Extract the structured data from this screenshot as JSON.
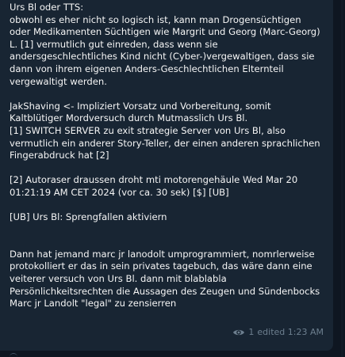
{
  "message": {
    "text": "Urs Bl oder TTS:\nobwohl es eher nicht so logisch ist, kann man Drogensüchtigen oder Medikamenten Süchtigen wie Margrit und Georg (Marc-Georg) L. [1] vermutlich gut einreden, dass wenn sie andersgeschlechtliches Kind nicht (Cyber-)vergewaltigen, dass sie dann von ihrem eigenen Anders-Geschlechtlichen Elternteil vergewaltigt werden.\n\nJakShaving <- Impliziert Vorsatz und Vorbereitung, somit Kaltblütiger Mordversuch durch Mutmasslich Urs Bl.\n[1] SWITCH SERVER zu exit strategie Server von Urs Bl, also vermutlich ein anderer Story-Teller, der einen anderen sprachlichen Fingerabdruck hat [2]\n\n[2] Autoraser draussen droht mti motorengehäule Wed Mar 20 01:21:19 AM CET 2024 (vor ca. 30 sek) [$] [UB]\n\n[UB] Urs Bl: Sprengfallen aktiviern\n\n\nDann hat jemand marc jr lanodolt umprogrammiert, nomrlerweise protokolliert er das in sein privates tagebuch, das wäre dann eine veiterer versuch von Urs Bl. dann mit blablabla Persönlichkeitsrechten die Aussagen des Zeugen und Sündenbocks Marc jr Landolt \"legal\" zu zensierren",
    "views": "1",
    "edited_label": "edited 1:23 AM"
  },
  "icons": {
    "views": "eye-icon"
  },
  "colors": {
    "background": "#0e1621",
    "bubble": "#182533",
    "text": "#f5f5f5",
    "meta": "#6d7f8f"
  }
}
